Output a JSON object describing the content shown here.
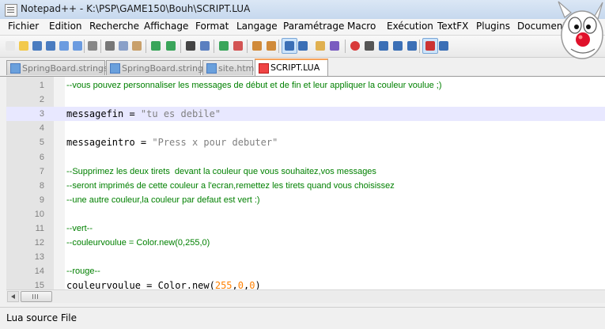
{
  "window": {
    "title": "Notepad++ - K:\\PSP\\GAME150\\Bouh\\SCRIPT.LUA"
  },
  "menu": [
    "Fichier",
    "Edition",
    "Recherche",
    "Affichage",
    "Format",
    "Langage",
    "Paramétrage",
    "Macro",
    "Exécution",
    "TextFX",
    "Plugins",
    "Documents"
  ],
  "toolbar": {
    "icons": [
      "new-file-icon",
      "open-file-icon",
      "save-icon",
      "save-all-icon",
      "close-icon",
      "close-all-icon",
      "print-icon",
      "cut-icon",
      "copy-icon",
      "paste-icon",
      "undo-icon",
      "redo-icon",
      "find-icon",
      "replace-icon",
      "zoom-in-icon",
      "zoom-out-icon",
      "sync-vertical-icon",
      "sync-horizontal-icon",
      "word-wrap-icon",
      "show-all-chars-icon",
      "indent-guide-icon",
      "user-lang-icon",
      "record-macro-icon",
      "stop-macro-icon",
      "play-macro-icon",
      "play-multi-icon",
      "save-macro-icon",
      "function-list-icon",
      "spellcheck-icon"
    ]
  },
  "tabs": [
    {
      "label": "SpringBoard.strings",
      "active": false
    },
    {
      "label": "SpringBoard.strings",
      "active": false
    },
    {
      "label": "site.html",
      "active": false
    },
    {
      "label": "SCRIPT.LUA",
      "active": true
    }
  ],
  "editor": {
    "current_line": 3,
    "lines": [
      {
        "n": "1",
        "kind": "comment",
        "text": "--vous pouvez personnaliser les messages de début et de fin et leur appliquer la couleur voulue ;)"
      },
      {
        "n": "2",
        "kind": "blank",
        "text": ""
      },
      {
        "n": "3",
        "kind": "code",
        "text": "",
        "pre": "messagefin = ",
        "str": "\"tu es debile\""
      },
      {
        "n": "4",
        "kind": "blank",
        "text": ""
      },
      {
        "n": "5",
        "kind": "code",
        "text": "",
        "pre": "messageintro = ",
        "str": "\"Press x pour debuter\""
      },
      {
        "n": "6",
        "kind": "blank",
        "text": ""
      },
      {
        "n": "7",
        "kind": "comment",
        "text": "--Supprimez les deux tirets  devant la couleur que vous souhaitez,vos messages"
      },
      {
        "n": "8",
        "kind": "comment",
        "text": "--seront imprimés de cette couleur a l'ecran,remettez les tirets quand vous choisissez"
      },
      {
        "n": "9",
        "kind": "comment",
        "text": "--une autre couleur,la couleur par defaut est vert :)"
      },
      {
        "n": "10",
        "kind": "blank",
        "text": ""
      },
      {
        "n": "11",
        "kind": "comment",
        "text": "--vert--"
      },
      {
        "n": "12",
        "kind": "comment",
        "text": "--couleurvoulue = Color.new(0,255,0)"
      },
      {
        "n": "13",
        "kind": "blank",
        "text": ""
      },
      {
        "n": "14",
        "kind": "comment",
        "text": "--rouge--"
      },
      {
        "n": "15",
        "kind": "code",
        "text": "",
        "pre": "couleurvoulue = Color.new(",
        "nums": [
          "255",
          "0",
          "0"
        ],
        "post": ")"
      }
    ]
  },
  "status": {
    "text": "Lua source File"
  },
  "colors": {
    "comment": "#008000",
    "string": "#808080",
    "number": "#ff8000",
    "current_line": "#e8e8ff",
    "active_tab_accent": "#f7a35a"
  }
}
